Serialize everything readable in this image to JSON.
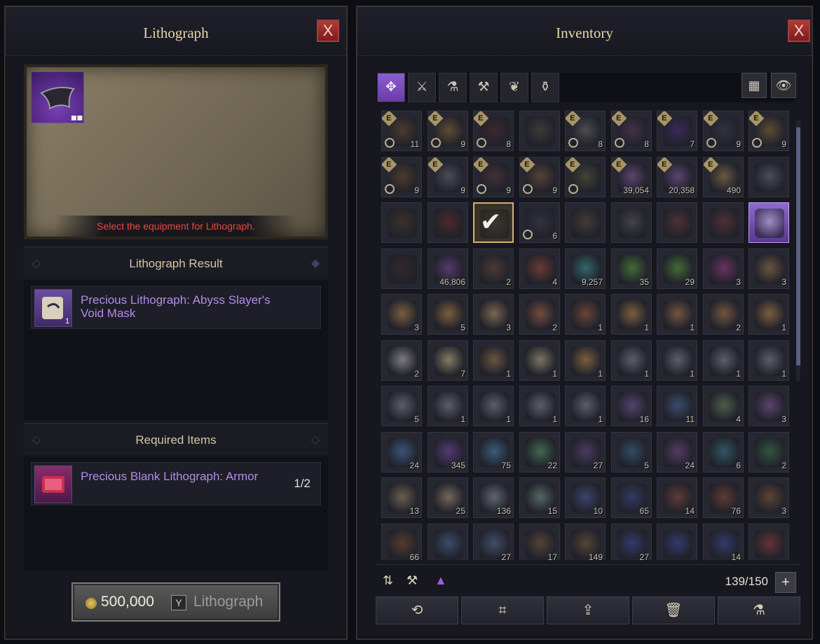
{
  "lithograph_panel": {
    "title": "Lithograph",
    "close": "X",
    "selected_equipment": {
      "icon": "void-mask-icon",
      "color": "#7b3fb8"
    },
    "hint": "Select the equipment for Lithograph.",
    "result_section": {
      "heading": "Lithograph Result",
      "item": {
        "name": "Precious Lithograph: Abyss Slayer's Void Mask",
        "quantity": "1",
        "icon": "scroll-icon"
      }
    },
    "required_section": {
      "heading": "Required Items",
      "item": {
        "name": "Precious Blank Lithograph: Armor",
        "count": "1/2",
        "icon": "blank-lithograph-icon"
      }
    },
    "cost_button": {
      "price": "500,000",
      "key": "Y",
      "label": "Lithograph"
    }
  },
  "inventory_panel": {
    "title": "Inventory",
    "close": "X",
    "filters": [
      {
        "name": "all-filter",
        "glyph": "✥",
        "active": true
      },
      {
        "name": "equipment-filter",
        "glyph": "⚔",
        "active": false
      },
      {
        "name": "consumable-filter",
        "glyph": "⚗",
        "active": false
      },
      {
        "name": "crafting-filter",
        "glyph": "⚒",
        "active": false
      },
      {
        "name": "material-filter",
        "glyph": "❦",
        "active": false
      },
      {
        "name": "misc-filter",
        "glyph": "⚱",
        "active": false
      }
    ],
    "view_toggle": "▦",
    "eye_toggle": "👁",
    "items": [
      {
        "n": "11",
        "e": true,
        "lock": true,
        "c": "#6b4a2a"
      },
      {
        "n": "9",
        "e": true,
        "lock": true,
        "c": "#8a6a3a"
      },
      {
        "n": "8",
        "e": true,
        "lock": true,
        "c": "#4a2a2a"
      },
      {
        "n": "",
        "e": false,
        "lock": false,
        "c": "#4a4a3a"
      },
      {
        "n": "8",
        "e": true,
        "lock": true,
        "c": "#6a6a6a"
      },
      {
        "n": "8",
        "e": true,
        "lock": true,
        "c": "#5a3a5a"
      },
      {
        "n": "7",
        "e": true,
        "lock": false,
        "c": "#4a2a7a"
      },
      {
        "n": "9",
        "e": true,
        "lock": true,
        "c": "#3a3a4a"
      },
      {
        "n": "9",
        "e": true,
        "lock": true,
        "c": "#8a6a3a"
      },
      {
        "n": "9",
        "e": true,
        "lock": true,
        "c": "#6b4a2a"
      },
      {
        "n": "9",
        "e": true,
        "lock": false,
        "c": "#6a6a7a"
      },
      {
        "n": "9",
        "e": true,
        "lock": true,
        "c": "#5a3a3a"
      },
      {
        "n": "9",
        "e": true,
        "lock": true,
        "c": "#7a5a3a"
      },
      {
        "n": "",
        "e": true,
        "lock": true,
        "c": "#5a5a3a"
      },
      {
        "n": "39,054",
        "e": true,
        "lock": false,
        "c": "#8a5aa0"
      },
      {
        "n": "20,358",
        "e": true,
        "lock": false,
        "c": "#8a5aa0"
      },
      {
        "n": "490",
        "e": true,
        "lock": false,
        "c": "#a08050"
      },
      {
        "n": "",
        "e": false,
        "lock": false,
        "c": "#6a6a7a"
      },
      {
        "n": "",
        "e": false,
        "lock": false,
        "c": "#4a3a2a"
      },
      {
        "n": "",
        "e": false,
        "lock": false,
        "c": "#6a2a2a"
      },
      {
        "n": "",
        "e": false,
        "lock": false,
        "c": "#3a3a3a",
        "sel": true
      },
      {
        "n": "6",
        "e": false,
        "lock": true,
        "c": "#3a3a4a"
      },
      {
        "n": "",
        "e": false,
        "lock": false,
        "c": "#5a4a3a"
      },
      {
        "n": "",
        "e": false,
        "lock": false,
        "c": "#5a5a5a"
      },
      {
        "n": "",
        "e": false,
        "lock": false,
        "c": "#6a3a3a"
      },
      {
        "n": "",
        "e": false,
        "lock": false,
        "c": "#6a3a3a"
      },
      {
        "n": "",
        "e": false,
        "lock": false,
        "c": "#c0c0d0",
        "hi": true
      },
      {
        "n": "",
        "e": false,
        "lock": false,
        "c": "#3a2a2a"
      },
      {
        "n": "46,806",
        "e": false,
        "lock": false,
        "c": "#7a4a9a"
      },
      {
        "n": "2",
        "e": false,
        "lock": false,
        "c": "#6a4a3a"
      },
      {
        "n": "4",
        "e": false,
        "lock": false,
        "c": "#a04a3a"
      },
      {
        "n": "9,257",
        "e": false,
        "lock": false,
        "c": "#3a9a9a"
      },
      {
        "n": "35",
        "e": false,
        "lock": false,
        "c": "#5aa03a"
      },
      {
        "n": "29",
        "e": false,
        "lock": false,
        "c": "#5aa03a"
      },
      {
        "n": "3",
        "e": false,
        "lock": false,
        "c": "#a03a8a"
      },
      {
        "n": "3",
        "e": false,
        "lock": false,
        "c": "#a07a4a"
      },
      {
        "n": "3",
        "e": false,
        "lock": false,
        "c": "#c08a4a"
      },
      {
        "n": "5",
        "e": false,
        "lock": false,
        "c": "#c08a4a"
      },
      {
        "n": "3",
        "e": false,
        "lock": false,
        "c": "#c09a6a"
      },
      {
        "n": "2",
        "e": false,
        "lock": false,
        "c": "#b06a4a"
      },
      {
        "n": "1",
        "e": false,
        "lock": false,
        "c": "#a05a3a"
      },
      {
        "n": "1",
        "e": false,
        "lock": false,
        "c": "#c08a4a"
      },
      {
        "n": "1",
        "e": false,
        "lock": false,
        "c": "#b07a4a"
      },
      {
        "n": "2",
        "e": false,
        "lock": false,
        "c": "#b07a4a"
      },
      {
        "n": "1",
        "e": false,
        "lock": false,
        "c": "#c08a4a"
      },
      {
        "n": "2",
        "e": false,
        "lock": false,
        "c": "#c0c0c0"
      },
      {
        "n": "7",
        "e": false,
        "lock": false,
        "c": "#d0c08a"
      },
      {
        "n": "1",
        "e": false,
        "lock": false,
        "c": "#a07a4a"
      },
      {
        "n": "1",
        "e": false,
        "lock": false,
        "c": "#c0b08a"
      },
      {
        "n": "1",
        "e": false,
        "lock": false,
        "c": "#c08a4a"
      },
      {
        "n": "1",
        "e": false,
        "lock": false,
        "c": "#8a8a9a"
      },
      {
        "n": "1",
        "e": false,
        "lock": false,
        "c": "#8a8a9a"
      },
      {
        "n": "1",
        "e": false,
        "lock": false,
        "c": "#8a8a9a"
      },
      {
        "n": "1",
        "e": false,
        "lock": false,
        "c": "#8a8a9a"
      },
      {
        "n": "5",
        "e": false,
        "lock": false,
        "c": "#8a8a9a"
      },
      {
        "n": "1",
        "e": false,
        "lock": false,
        "c": "#8a8a9a"
      },
      {
        "n": "1",
        "e": false,
        "lock": false,
        "c": "#8a8a9a"
      },
      {
        "n": "1",
        "e": false,
        "lock": false,
        "c": "#8a8a9a"
      },
      {
        "n": "1",
        "e": false,
        "lock": false,
        "c": "#8a8a9a"
      },
      {
        "n": "16",
        "e": false,
        "lock": false,
        "c": "#7a5aa0"
      },
      {
        "n": "11",
        "e": false,
        "lock": false,
        "c": "#4a6aa0"
      },
      {
        "n": "4",
        "e": false,
        "lock": false,
        "c": "#6a8a5a"
      },
      {
        "n": "3",
        "e": false,
        "lock": false,
        "c": "#8a5aa0"
      },
      {
        "n": "24",
        "e": false,
        "lock": false,
        "c": "#4a7ab0"
      },
      {
        "n": "345",
        "e": false,
        "lock": false,
        "c": "#7a4ab0"
      },
      {
        "n": "75",
        "e": false,
        "lock": false,
        "c": "#4a8ab0"
      },
      {
        "n": "22",
        "e": false,
        "lock": false,
        "c": "#5a9a6a"
      },
      {
        "n": "27",
        "e": false,
        "lock": false,
        "c": "#6a4a8a"
      },
      {
        "n": "5",
        "e": false,
        "lock": false,
        "c": "#3a6a8a"
      },
      {
        "n": "24",
        "e": false,
        "lock": false,
        "c": "#7a4a8a"
      },
      {
        "n": "6",
        "e": false,
        "lock": false,
        "c": "#3a7a8a"
      },
      {
        "n": "2",
        "e": false,
        "lock": false,
        "c": "#3a7a4a"
      },
      {
        "n": "13",
        "e": false,
        "lock": false,
        "c": "#a08a6a"
      },
      {
        "n": "25",
        "e": false,
        "lock": false,
        "c": "#b09a7a"
      },
      {
        "n": "136",
        "e": false,
        "lock": false,
        "c": "#8a9aa0"
      },
      {
        "n": "15",
        "e": false,
        "lock": false,
        "c": "#7a9a8a"
      },
      {
        "n": "10",
        "e": false,
        "lock": false,
        "c": "#4a5a9a"
      },
      {
        "n": "65",
        "e": false,
        "lock": false,
        "c": "#3a4a8a"
      },
      {
        "n": "14",
        "e": false,
        "lock": false,
        "c": "#8a4a3a"
      },
      {
        "n": "76",
        "e": false,
        "lock": false,
        "c": "#8a4a3a"
      },
      {
        "n": "3",
        "e": false,
        "lock": false,
        "c": "#8a5a3a"
      },
      {
        "n": "66",
        "e": false,
        "lock": false,
        "c": "#7a4a2a"
      },
      {
        "n": "",
        "e": false,
        "lock": false,
        "c": "#4a6a9a"
      },
      {
        "n": "27",
        "e": false,
        "lock": false,
        "c": "#5a6a9a"
      },
      {
        "n": "17",
        "e": false,
        "lock": false,
        "c": "#7a5a3a"
      },
      {
        "n": "149",
        "e": false,
        "lock": false,
        "c": "#7a5a3a"
      },
      {
        "n": "27",
        "e": false,
        "lock": false,
        "c": "#3a4a9a"
      },
      {
        "n": "",
        "e": false,
        "lock": false,
        "c": "#3a4a9a"
      },
      {
        "n": "14",
        "e": false,
        "lock": false,
        "c": "#3a4a9a"
      },
      {
        "n": "",
        "e": false,
        "lock": false,
        "c": "#9a3a3a"
      }
    ],
    "bottom_icons": [
      "⇅",
      "⚒",
      "▲"
    ],
    "count": "139/150",
    "expand": "+",
    "actions": [
      {
        "name": "auto-sort-button",
        "glyph": "⟲"
      },
      {
        "name": "map-button",
        "glyph": "⌗"
      },
      {
        "name": "upgrade-button",
        "glyph": "⇪"
      },
      {
        "name": "delete-button",
        "glyph": "🗑"
      },
      {
        "name": "alchemy-button",
        "glyph": "⚗"
      }
    ]
  }
}
